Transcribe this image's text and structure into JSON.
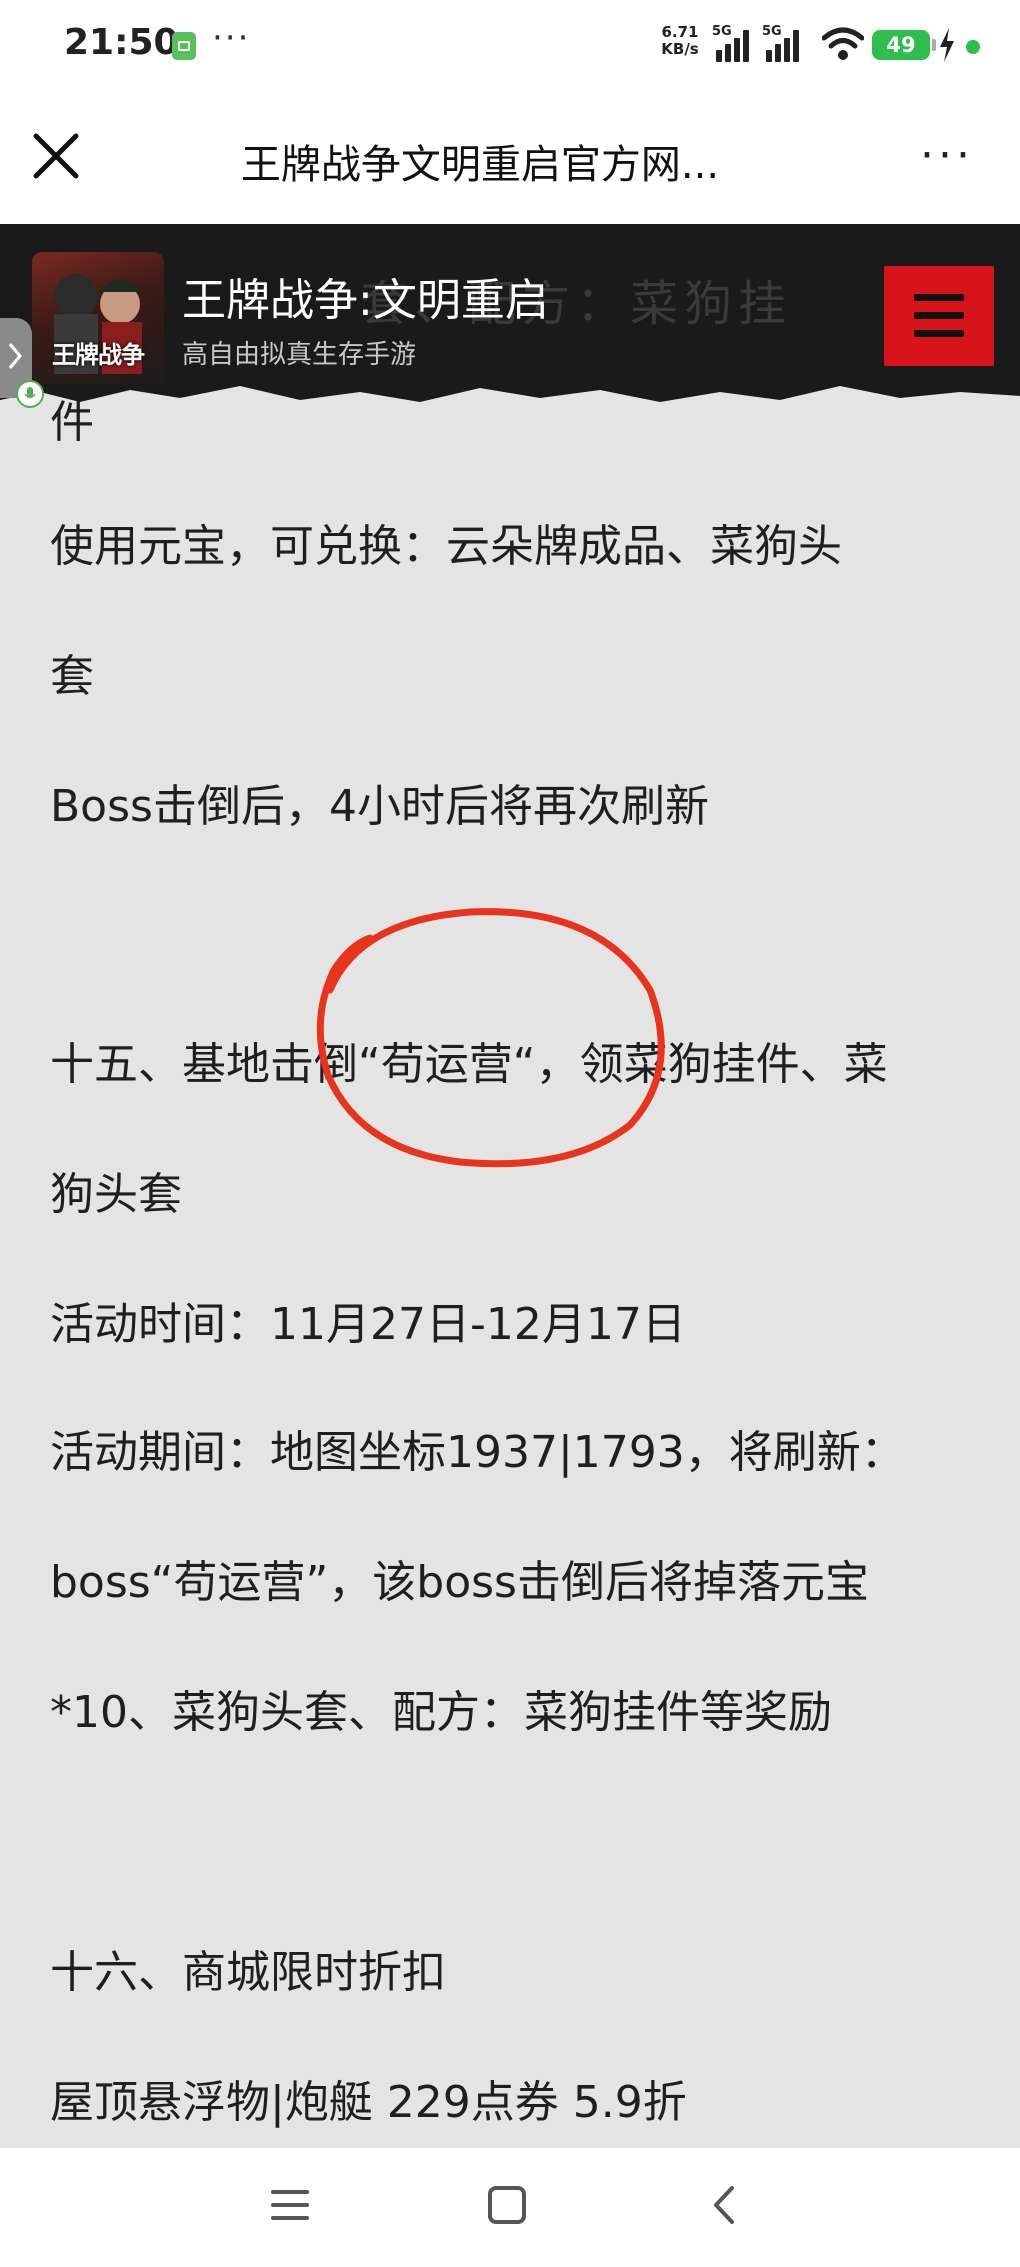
{
  "status_bar": {
    "time": "21:50",
    "menu_dots": "···",
    "net_speed_value": "6.71",
    "net_speed_unit": "KB/s",
    "signal1_label": "5G",
    "signal2_label": "5G",
    "battery": "49"
  },
  "header": {
    "title": "王牌战争文明重启官方网...",
    "more_label": "···"
  },
  "banner": {
    "game_name": "王牌战争:文明重启",
    "slogan": "高自由拟真生存手游",
    "logo_text": "王牌战争",
    "background_text": "套、配方：菜狗挂"
  },
  "article": {
    "lines": [
      "件",
      "使用元宝，可兑换：云朵牌成品、菜狗头",
      "套",
      "Boss击倒后，4小时后将再次刷新",
      "十五、基地击倒“苟运营“，领菜狗挂件、菜",
      "狗头套",
      "活动时间：11月27日-12月17日",
      "活动期间：地图坐标1937|1793，将刷新：",
      "boss“苟运营”，该boss击倒后将掉落元宝",
      "*10、菜狗头套、配方：菜狗挂件等奖励",
      "十六、商城限时折扣",
      "屋顶悬浮物|炮艇 229点券 5.9折"
    ]
  },
  "colors": {
    "page_background": "#e4e4e4",
    "banner_background": "#1a1a1a",
    "menu_button": "#d7141a",
    "annotation_red": "#e8341c",
    "battery_green": "#2fbe4e"
  },
  "icons": {
    "close": "close-icon",
    "more": "more-dots-icon",
    "menu": "hamburger-menu-icon",
    "nav_recents": "nav-recents-icon",
    "nav_home": "nav-home-icon",
    "nav_back": "nav-back-icon"
  }
}
